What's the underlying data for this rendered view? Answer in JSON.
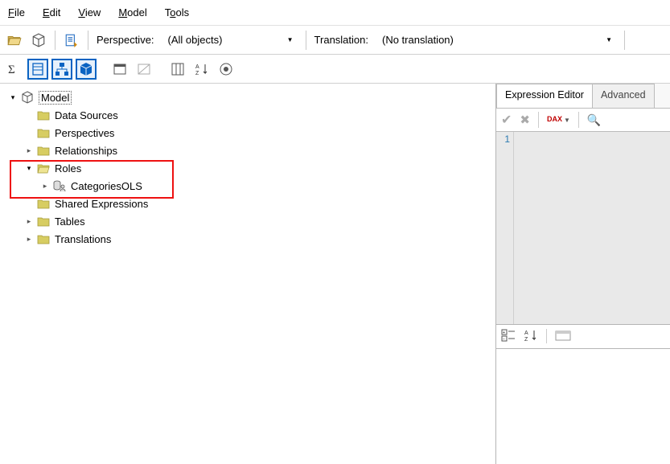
{
  "menu": {
    "file": "File",
    "edit": "Edit",
    "view": "View",
    "model": "Model",
    "tools": "Tools"
  },
  "toolbar1": {
    "perspective_label": "Perspective:",
    "perspective_value": "(All objects)",
    "translation_label": "Translation:",
    "translation_value": "(No translation)"
  },
  "tree": {
    "root": "Model",
    "data_sources": "Data Sources",
    "perspectives": "Perspectives",
    "relationships": "Relationships",
    "roles": "Roles",
    "role_item": "CategoriesOLS",
    "shared_expressions": "Shared Expressions",
    "tables": "Tables",
    "translations": "Translations"
  },
  "right": {
    "tab1": "Expression Editor",
    "tab2": "Advanced",
    "gutter_line": "1",
    "dax_label": "DAX"
  }
}
